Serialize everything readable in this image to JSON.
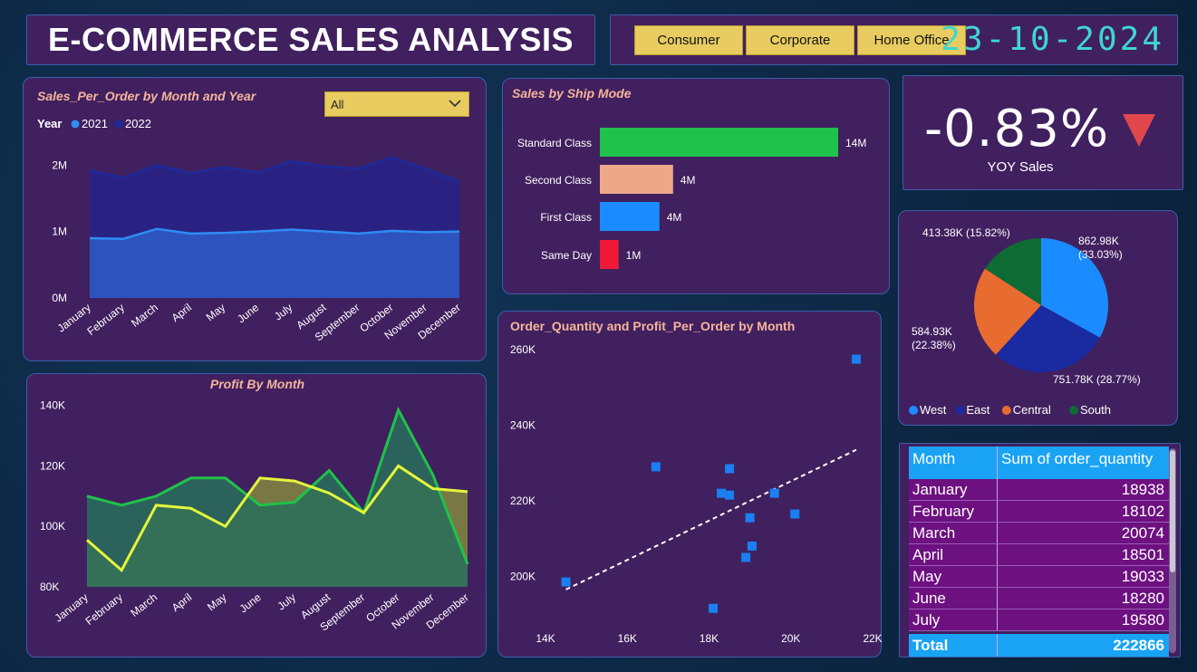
{
  "header": {
    "title": "E-COMMERCE SALES ANALYSIS",
    "segments": [
      "Consumer",
      "Corporate",
      "Home Office"
    ],
    "date": "23-10-2024"
  },
  "colors": {
    "panel": "#41205f",
    "border": "#3a5fa8",
    "accent_yellow": "#e8cc60",
    "date_teal": "#3fd6d0",
    "title_peach": "#f4b59b",
    "series_2021": "#2f8cf4",
    "series_2022": "#1d2a9c",
    "profit_green": "#1fc24a",
    "profit_yellow": "#e6f53b",
    "kpi_down": "#e0474c"
  },
  "sales_per_order": {
    "dropdown_value": "All",
    "dropdown_icon": "chevron-down-icon",
    "legend_title": "Year"
  },
  "kpi": {
    "value": "-0.83%",
    "label": "YOY Sales",
    "icon": "triangle-down-icon"
  },
  "table": {
    "headers": [
      "Month",
      "Sum of order_quantity"
    ],
    "rows": [
      [
        "January",
        "18938"
      ],
      [
        "February",
        "18102"
      ],
      [
        "March",
        "20074"
      ],
      [
        "April",
        "18501"
      ],
      [
        "May",
        "19033"
      ],
      [
        "June",
        "18280"
      ],
      [
        "July",
        "19580"
      ]
    ],
    "total_label": "Total",
    "total_value": "222866"
  },
  "chart_data": [
    {
      "id": "sales_per_order",
      "type": "area",
      "title": "Sales_Per_Order by Month and Year",
      "categories": [
        "January",
        "February",
        "March",
        "April",
        "May",
        "June",
        "July",
        "August",
        "September",
        "October",
        "November",
        "December"
      ],
      "series": [
        {
          "name": "2021",
          "values": [
            0.9,
            0.89,
            1.04,
            0.97,
            0.98,
            1.0,
            1.03,
            1.0,
            0.97,
            1.01,
            0.99,
            1.0
          ]
        },
        {
          "name": "2022",
          "values": [
            1.92,
            1.81,
            2.0,
            1.88,
            1.97,
            1.89,
            2.06,
            1.98,
            1.95,
            2.12,
            1.94,
            1.75
          ]
        }
      ],
      "y_ticks": [
        "0M",
        "1M",
        "2M"
      ],
      "ylim": [
        0,
        2.4
      ],
      "stacked": false,
      "legend": "top-left"
    },
    {
      "id": "ship_mode",
      "type": "bar",
      "orientation": "horizontal",
      "title": "Sales by Ship Mode",
      "categories": [
        "Standard Class",
        "Second Class",
        "First Class",
        "Same Day"
      ],
      "values": [
        14,
        4.3,
        3.5,
        1.1
      ],
      "value_labels": [
        "14M",
        "4M",
        "4M",
        "1M"
      ],
      "colors": [
        "#1fc24a",
        "#eda88a",
        "#1a8cff",
        "#f01a36"
      ]
    },
    {
      "id": "region_pie",
      "type": "pie",
      "slices": [
        {
          "name": "West",
          "value": 862.98,
          "label": "862.98K",
          "pct": "(33.03%)",
          "color": "#1a8cff"
        },
        {
          "name": "East",
          "value": 751.78,
          "label": "751.78K",
          "pct": "(28.77%)",
          "color": "#1a2aa0"
        },
        {
          "name": "Central",
          "value": 584.93,
          "label": "584.93K",
          "pct": "(22.38%)",
          "color": "#e86b30"
        },
        {
          "name": "South",
          "value": 413.38,
          "label": "413.38K",
          "pct": "(15.82%)",
          "color": "#0e6b34"
        }
      ],
      "legend": "bottom"
    },
    {
      "id": "profit_by_month",
      "type": "area",
      "title": "Profit By Month",
      "categories": [
        "January",
        "February",
        "March",
        "April",
        "May",
        "June",
        "July",
        "August",
        "September",
        "October",
        "November",
        "December"
      ],
      "series": [
        {
          "values": [
            110,
            107,
            110,
            116,
            116,
            107,
            108,
            118.5,
            104.5,
            138.5,
            117,
            87.5
          ]
        },
        {
          "values": [
            95.5,
            85.5,
            107,
            106,
            100,
            116,
            115,
            111,
            104.5,
            120,
            112.5,
            111.5
          ]
        }
      ],
      "y_ticks": [
        "80K",
        "100K",
        "120K",
        "140K"
      ],
      "ylim": [
        80,
        142
      ]
    },
    {
      "id": "qty_vs_profit",
      "type": "scatter",
      "title": "Order_Quantity and Profit_Per_Order by Month",
      "points": [
        {
          "x": 14.5,
          "y": 198.5
        },
        {
          "x": 16.7,
          "y": 229
        },
        {
          "x": 18.1,
          "y": 191.5
        },
        {
          "x": 18.3,
          "y": 222
        },
        {
          "x": 18.5,
          "y": 228.5
        },
        {
          "x": 18.5,
          "y": 221.5
        },
        {
          "x": 18.9,
          "y": 205
        },
        {
          "x": 19.0,
          "y": 215.5
        },
        {
          "x": 19.05,
          "y": 208
        },
        {
          "x": 19.6,
          "y": 222
        },
        {
          "x": 20.1,
          "y": 216.5
        },
        {
          "x": 21.6,
          "y": 257.5
        }
      ],
      "trendline": {
        "x1": 14.5,
        "y1": 196.5,
        "x2": 21.6,
        "y2": 233.5
      },
      "x_ticks": [
        "14K",
        "16K",
        "18K",
        "20K",
        "22K"
      ],
      "y_ticks": [
        "200K",
        "220K",
        "240K",
        "260K"
      ],
      "xlim": [
        14,
        22
      ],
      "ylim": [
        190,
        261
      ]
    }
  ]
}
